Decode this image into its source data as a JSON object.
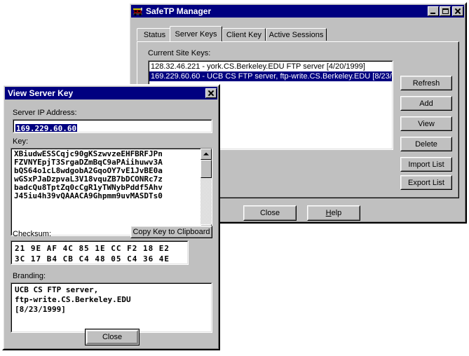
{
  "main_window": {
    "title": "SafeTP Manager",
    "icon": "safetp-app-icon",
    "buttons": {
      "minimize": "minimize-icon",
      "maximize": "maximize-icon",
      "close": "close-icon"
    },
    "tabs": [
      {
        "label": "Status",
        "active": false
      },
      {
        "label": "Server Keys",
        "active": true
      },
      {
        "label": "Client Key",
        "active": false
      },
      {
        "label": "Active Sessions",
        "active": false
      }
    ],
    "list_label": "Current Site Keys:",
    "list_items": [
      {
        "text": "128.32.46.221 - york.CS.Berkeley.EDU FTP server [4/20/1999]",
        "selected": false
      },
      {
        "text": "169.229.60.60 - UCB CS FTP server, ftp-write.CS.Berkeley.EDU [8/23/1",
        "selected": true
      }
    ],
    "side_buttons": [
      "Refresh",
      "Add",
      "View",
      "Delete",
      "Import List",
      "Export List"
    ],
    "bottom_buttons": [
      {
        "label": "Close",
        "accel": ""
      },
      {
        "label": "Help",
        "accel": "H"
      }
    ]
  },
  "dialog": {
    "title": "View Server Key",
    "close_button": "close-icon",
    "ip_label": "Server IP Address:",
    "ip_value": "169.229.60.60",
    "key_label": "Key:",
    "key_lines": [
      "XBiudwESSCqjc90gKSzwvzeEHFBRFJPn",
      "FZVNYEpjT3SrgaDZmBqC9aPAiihuwv3A",
      "bQS64o1cL8wdgobA2GqoOY7vE1JvBE0a",
      "wGSxPJaDzpvaL3V18vquZB7bDCONRc7z",
      "badcQu8TptZq0cCgR1yTWNybPddf5Ahv",
      "J45iu4h39vQAAACA9Ghpmm9uvMASDTs0"
    ],
    "checksum_label": "Checksum:",
    "copy_button": "Copy Key to Clipboard",
    "checksum_rows": [
      "21 9E AF 4C 85 1E CC F2 18 E2",
      "3C 17 B4 CB C4 48 05 C4 36 4E"
    ],
    "branding_label": "Branding:",
    "branding_lines": [
      "UCB CS FTP server,",
      "ftp-write.CS.Berkeley.EDU",
      "[8/23/1999]"
    ],
    "close_label": "Close"
  },
  "colors": {
    "face": "#c0c0c0",
    "titlebar_active": "#000080",
    "selection": "#000080",
    "window_bg": "#ffffff",
    "text": "#000000",
    "desktop": "#ffffff"
  }
}
